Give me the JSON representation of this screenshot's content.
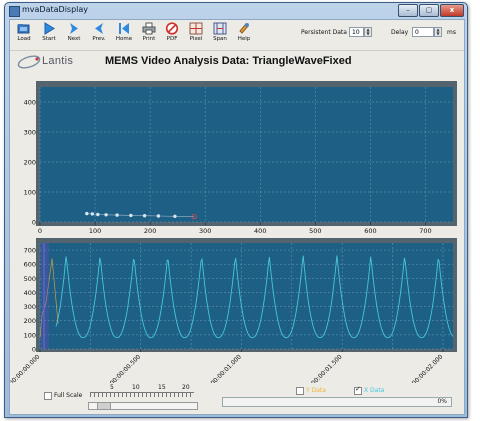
{
  "window": {
    "title": "mvaDataDisplay",
    "buttons": [
      "–",
      "▢",
      "x"
    ]
  },
  "toolbar": {
    "buttons": [
      {
        "label": "Load",
        "icon": "folder-open-icon"
      },
      {
        "label": "Start",
        "icon": "play-icon"
      },
      {
        "label": "Next",
        "icon": "next-icon"
      },
      {
        "label": "Prev.",
        "icon": "previous-icon"
      },
      {
        "label": "Home",
        "icon": "home-icon"
      },
      {
        "label": "Print",
        "icon": "printer-icon"
      },
      {
        "label": "PDF",
        "icon": "pdf-icon"
      },
      {
        "label": "Pixel",
        "icon": "pixel-grid-icon"
      },
      {
        "label": "Span",
        "icon": "span-icon"
      },
      {
        "label": "Help",
        "icon": "help-icon"
      }
    ],
    "persistent_label": "Persistent Data",
    "persistent_value": "10",
    "delay_label": "Delay",
    "delay_value": "0",
    "delay_unit": "ms"
  },
  "header": {
    "logo_text": "Lantis",
    "title": "MEMS Video Analysis Data: TriangleWaveFixed"
  },
  "colors": {
    "plot_bg": "#1d5f85",
    "frame": "#54646f",
    "wave": "#46c6dc",
    "point": "#d8e6f2",
    "last_point": "#e84a4a",
    "y_data": "#f0b43a",
    "x_data": "#46c6dc"
  },
  "chart_data": [
    {
      "type": "scatter",
      "title": "",
      "xlabel": "",
      "ylabel": "",
      "xlim": [
        0,
        750
      ],
      "ylim": [
        0,
        450
      ],
      "xticks": [
        0,
        100,
        200,
        300,
        400,
        500,
        600,
        700
      ],
      "yticks": [
        0,
        100,
        200,
        300,
        400
      ],
      "grid": true,
      "series": [
        {
          "x": [
            85,
            95,
            105,
            120,
            140,
            165,
            190,
            215,
            245,
            280
          ],
          "y": [
            28,
            27,
            25,
            24,
            23,
            22,
            21,
            20,
            19,
            18
          ]
        }
      ]
    },
    {
      "type": "line",
      "title": "",
      "xlabel": "",
      "ylabel": "",
      "ylim": [
        0,
        750
      ],
      "yticks": [
        0,
        100,
        200,
        300,
        400,
        500,
        600,
        700
      ],
      "xticks": [
        "00:00:00.000",
        "00:00:00.500",
        "00:00:01.000",
        "00:00:01.500",
        "00:00:02.000"
      ],
      "x_seconds_range": [
        0,
        2.05
      ],
      "grid": true,
      "series": [
        {
          "name": "Y Data",
          "points": [
            [
              0,
              80
            ],
            [
              0.01,
              240
            ],
            [
              0.03,
              330
            ],
            [
              0.06,
              640
            ],
            [
              0.09,
              180
            ]
          ]
        },
        {
          "name": "X Data",
          "period": 0.168,
          "min": 80,
          "max": 665,
          "first_peak": 0.13
        }
      ],
      "cursor_x": 0.02,
      "legend_position": "bottom"
    }
  ],
  "bottom": {
    "full_scale_label": "Full Scale",
    "slider_ticks": [
      "5",
      "10",
      "15",
      "20"
    ],
    "y_data_label": "Y Data",
    "x_data_label": "X Data",
    "progress_value": 0,
    "progress_label": "0%",
    "y_data_checked": false,
    "x_data_checked": true
  }
}
